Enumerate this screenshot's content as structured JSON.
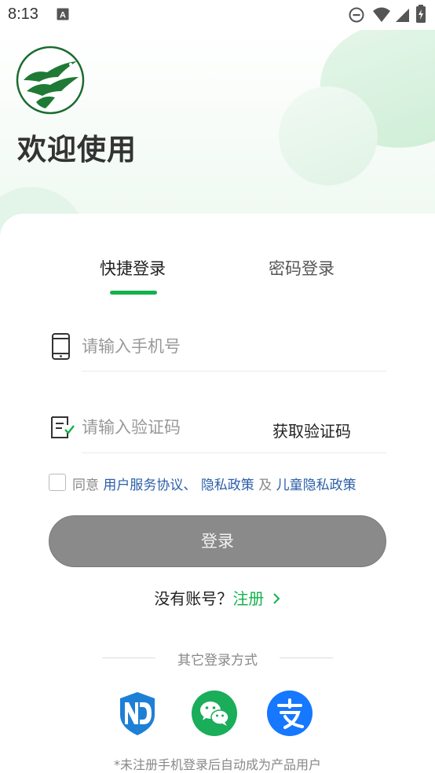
{
  "status_bar": {
    "time": "8:13"
  },
  "header": {
    "welcome": "欢迎使用"
  },
  "tabs": {
    "quick_login": "快捷登录",
    "password_login": "密码登录",
    "active": "quick_login"
  },
  "form": {
    "phone_placeholder": "请输入手机号",
    "code_placeholder": "请输入验证码",
    "get_code_label": "获取验证码"
  },
  "agreement": {
    "prefix": "同意",
    "user_agreement": "用户服务协议、",
    "privacy": "隐私政策",
    "and": "及",
    "child_privacy": "儿童隐私政策",
    "checked": false
  },
  "login_button": "登录",
  "register": {
    "question": "没有账号？",
    "link": "注册",
    "chevron": ">"
  },
  "other_login": {
    "title": "其它登录方式",
    "providers": [
      "nd-logo-icon",
      "wechat-icon",
      "alipay-icon"
    ]
  },
  "footnote": "*未注册手机登录后自动成为产品用户",
  "colors": {
    "accent": "#13b24c",
    "link": "#2c5fa8",
    "button_disabled": "#8a8a8a"
  }
}
